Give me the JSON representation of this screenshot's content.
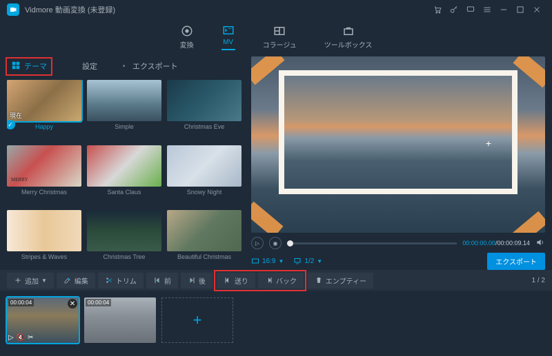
{
  "app": {
    "title": "Vidmore 動画変換 (未登録)"
  },
  "maintabs": {
    "convert": "変換",
    "mv": "MV",
    "collage": "コラージュ",
    "toolbox": "ツールボックス"
  },
  "subtabs": {
    "theme": "テーマ",
    "settings": "設定",
    "export": "エクスポート"
  },
  "themes": [
    {
      "id": "happy",
      "name": "Happy",
      "label": "現在",
      "selected": true,
      "cls": "th-happy"
    },
    {
      "id": "simple",
      "name": "Simple",
      "label": "",
      "selected": false,
      "cls": "th-simple"
    },
    {
      "id": "xmas-eve",
      "name": "Christmas Eve",
      "label": "",
      "selected": false,
      "cls": "th-xmas-eve"
    },
    {
      "id": "merry",
      "name": "Merry Christmas",
      "label": "",
      "selected": false,
      "cls": "th-merry"
    },
    {
      "id": "santa",
      "name": "Santa Claus",
      "label": "",
      "selected": false,
      "cls": "th-santa"
    },
    {
      "id": "snowy",
      "name": "Snowy Night",
      "label": "",
      "selected": false,
      "cls": "th-snowy"
    },
    {
      "id": "stripes",
      "name": "Stripes & Waves",
      "label": "",
      "selected": false,
      "cls": "th-stripes"
    },
    {
      "id": "tree",
      "name": "Christmas Tree",
      "label": "",
      "selected": false,
      "cls": "th-tree"
    },
    {
      "id": "beautiful",
      "name": "Beautiful Christmas",
      "label": "",
      "selected": false,
      "cls": "th-beautiful"
    }
  ],
  "player": {
    "current_time": "00:00:00.00",
    "duration": "00:00:09.14",
    "aspect": "16:9",
    "page": "1/2"
  },
  "export_button": "エクスポート",
  "toolbar": {
    "add": "追加",
    "edit": "編集",
    "trim": "トリム",
    "front": "前",
    "back": "後",
    "forward": "送り",
    "rewind": "バック",
    "empty": "エンプティー",
    "pager": "1 / 2"
  },
  "clips": [
    {
      "duration": "00:00:04",
      "selected": true
    },
    {
      "duration": "00:00:04",
      "selected": false
    }
  ],
  "merry_label": "MERRY",
  "highlights": {
    "theme_tab": true,
    "forward_rewind": true
  }
}
